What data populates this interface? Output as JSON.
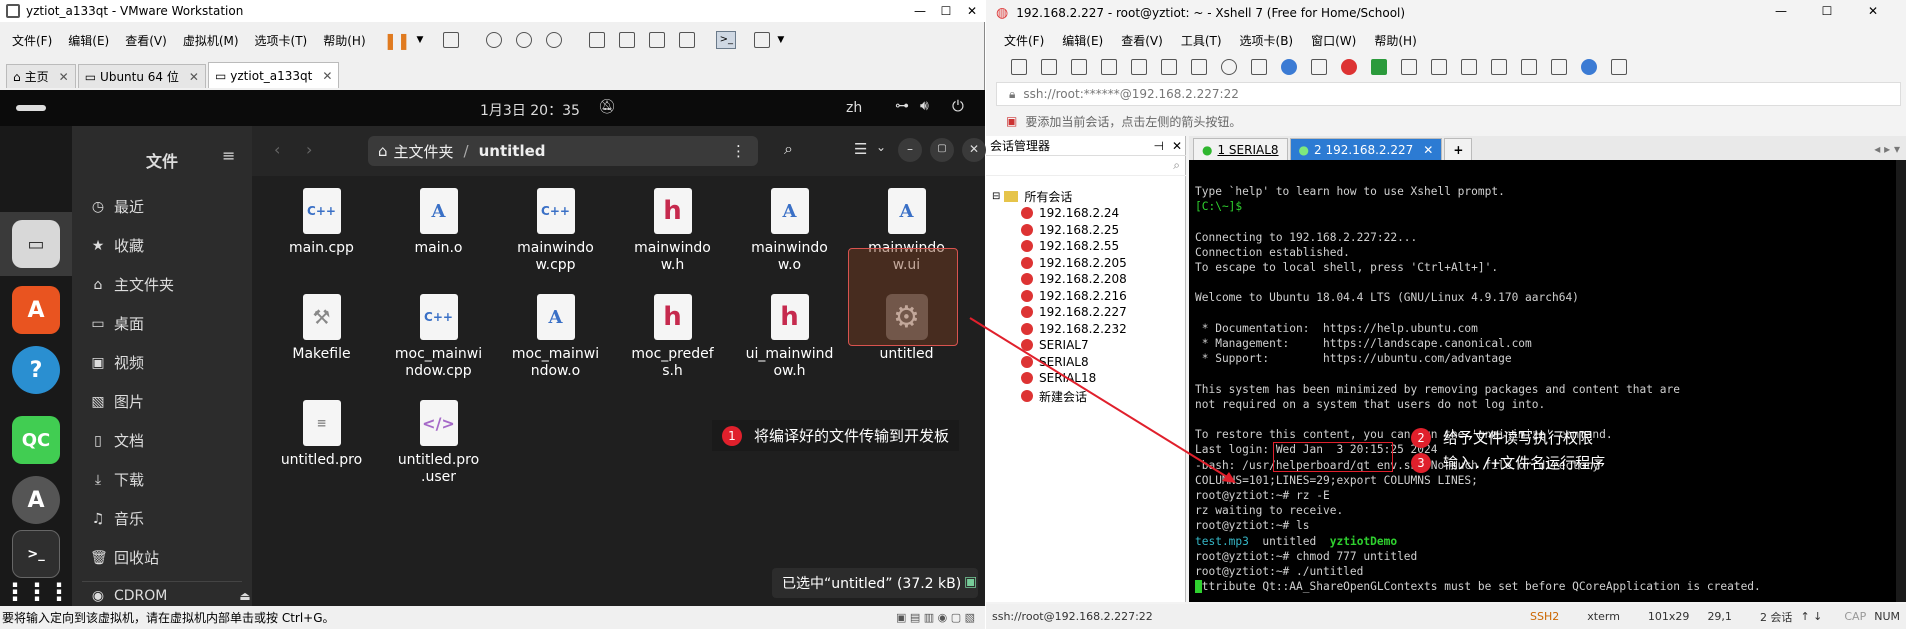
{
  "vmware": {
    "title": "yztiot_a133qt - VMware Workstation",
    "menu": [
      "文件(F)",
      "编辑(E)",
      "查看(V)",
      "虚拟机(M)",
      "选项卡(T)",
      "帮助(H)"
    ],
    "tabs": [
      "主页",
      "Ubuntu 64 位",
      "yztiot_a133qt"
    ],
    "status": "要将输入定向到该虚拟机，请在虚拟机内部单击或按 Ctrl+G。"
  },
  "ubuntu": {
    "clock": "1月3日  20：35",
    "lang": "zh",
    "sidebar_title": "文件",
    "sidebar_items": [
      "最近",
      "收藏",
      "主文件夹",
      "桌面",
      "视频",
      "图片",
      "文档",
      "下载",
      "音乐",
      "回收站",
      "CDROM"
    ],
    "path_home": "主文件夹",
    "path_sep": "/",
    "path_current": "untitled",
    "files": [
      {
        "name": "main.cpp",
        "type": "cpp",
        "icon_text": "C++"
      },
      {
        "name": "main.o",
        "type": "o",
        "icon_text": "A"
      },
      {
        "name": "mainwindo\nw.cpp",
        "type": "cpp",
        "icon_text": "C++"
      },
      {
        "name": "mainwindo\nw.h",
        "type": "h",
        "icon_text": "h"
      },
      {
        "name": "mainwindo\nw.o",
        "type": "o",
        "icon_text": "A"
      },
      {
        "name": "mainwindo\nw.ui",
        "type": "o",
        "icon_text": "A"
      },
      {
        "name": "Makefile",
        "type": "mk",
        "icon_text": "⚒"
      },
      {
        "name": "moc_mainwi\nndow.cpp",
        "type": "cpp",
        "icon_text": "C++"
      },
      {
        "name": "moc_mainwi\nndow.o",
        "type": "o",
        "icon_text": "A"
      },
      {
        "name": "moc_predef\ns.h",
        "type": "h",
        "icon_text": "h"
      },
      {
        "name": "ui_mainwind\now.h",
        "type": "h",
        "icon_text": "h"
      },
      {
        "name": "untitled",
        "type": "exe",
        "icon_text": "⚙"
      },
      {
        "name": "untitled.pro",
        "type": "txt",
        "icon_text": "≡"
      },
      {
        "name": "untitled.pro\n.user",
        "type": "user",
        "icon_text": "</>"
      }
    ],
    "selection_status": "已选中“untitled” (37.2 kB)",
    "annotation1": "将编译好的文件传输到开发板"
  },
  "xshell": {
    "title": "192.168.2.227 - root@yztiot: ~ - Xshell 7 (Free for Home/School)",
    "menu": [
      "文件(F)",
      "编辑(E)",
      "查看(V)",
      "工具(T)",
      "选项卡(B)",
      "窗口(W)",
      "帮助(H)"
    ],
    "address": "ssh://root:******@192.168.2.227:22",
    "hint": "要添加当前会话，点击左侧的箭头按钮。",
    "session_manager_title": "会话管理器",
    "session_root": "所有会话",
    "sessions": [
      "192.168.2.24",
      "192.168.2.25",
      "192.168.2.55",
      "192.168.2.205",
      "192.168.2.208",
      "192.168.2.216",
      "192.168.2.227",
      "192.168.2.232",
      "SERIAL7",
      "SERIAL8",
      "SERIAL18",
      "新建会话"
    ],
    "tabs": [
      "1 SERIAL8",
      "2 192.168.2.227"
    ],
    "terminal_lines": [
      "Type `help' to learn how to use Xshell prompt.",
      "[C:\\~]$",
      "",
      "Connecting to 192.168.2.227:22...",
      "Connection established.",
      "To escape to local shell, press 'Ctrl+Alt+]'.",
      "",
      "Welcome to Ubuntu 18.04.4 LTS (GNU/Linux 4.9.170 aarch64)",
      "",
      " * Documentation:  https://help.ubuntu.com",
      " * Management:     https://landscape.canonical.com",
      " * Support:        https://ubuntu.com/advantage",
      "",
      "This system has been minimized by removing packages and content that are",
      "not required on a system that users do not log into.",
      "",
      "To restore this content, you can run the 'unminimize' command.",
      "Last login: Wed Jan  3 20:15:25 2024",
      "-bash: /usr/helperboard/qt_env.sh: No such file or directory",
      "COLUMNS=101;LINES=29;export COLUMNS LINES;",
      "root@yztiot:~# rz -E",
      "rz waiting to receive.",
      "root@yztiot:~# ls",
      "test.mp3  untitled  yztiotDemo",
      "root@yztiot:~# chmod 777 untitled",
      "root@yztiot:~# ./untitled",
      "Attribute Qt::AA_ShareOpenGLContexts must be set before QCoreApplication is created."
    ],
    "annotation2": "给予文件读写执行权限",
    "annotation3": "输入./+文件名运行程序",
    "status": {
      "conn": "ssh://root@192.168.2.227:22",
      "proto": "SSH2",
      "term": "xterm",
      "size": "101x29",
      "pos": "29,1",
      "sessions": "2 会话",
      "caps": "CAP",
      "num": "NUM"
    }
  },
  "annotation_numbers": [
    "1",
    "2",
    "3"
  ],
  "colors": {
    "accent_red": "#e0202c",
    "terminal_green": "#2fd12f",
    "terminal_cyan": "#35b6c6",
    "xshell_tab_blue": "#2c7bd3"
  }
}
